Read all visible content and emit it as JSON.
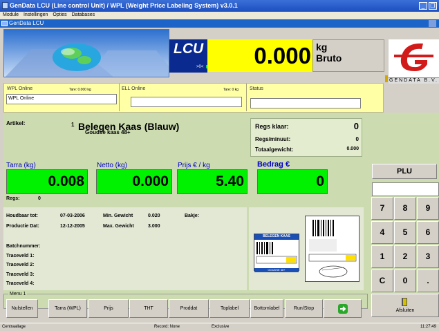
{
  "window": {
    "title": "GenData LCU (Line control Unit) / WPL (Weight Price Labeling System)  v3.0.1"
  },
  "menu": [
    "Module",
    "Instellingen",
    "Opties",
    "Databases"
  ],
  "subwindow": {
    "title": "GenData LCU"
  },
  "lcu": {
    "label": "LCU",
    "sub": ">0<"
  },
  "weight": {
    "value": "0.000",
    "unit": "kg",
    "mode": "Bruto"
  },
  "logo": {
    "text": "GENDATA B.V."
  },
  "wpl": {
    "label": "WPL Online",
    "tare": "Tare: 0.000 kg",
    "value": "WPL Online"
  },
  "ell": {
    "label": "ELL Online",
    "tare": "Tare: 0 kg",
    "value": ""
  },
  "status": {
    "label": "Status",
    "value": ""
  },
  "article": {
    "label": "Artikel:",
    "number": "1",
    "name": "Belegen Kaas (Blauw)",
    "sub": "Goudse kaas 48+"
  },
  "summary": {
    "regs_klaar_label": "Regs klaar:",
    "regs_klaar": "0",
    "regs_min_label": "Regs/minuut:",
    "regs_min": "0",
    "totaal_label": "Totaalgewicht:",
    "totaal": "0.000"
  },
  "fields": {
    "tarra_label": "Tarra (kg)",
    "tarra": "0.008",
    "netto_label": "Netto (kg)",
    "netto": "0.000",
    "prijs_label": "Prijs € / kg",
    "prijs": "5.40",
    "bedrag_label": "Bedrag €",
    "bedrag": "0"
  },
  "regs": {
    "label": "Regs:",
    "value": "0"
  },
  "info": {
    "houdbaar_label": "Houdbaar tot:",
    "houdbaar": "07-03-2006",
    "min_label": "Min. Gewicht",
    "min": "0.020",
    "bakje_label": "Bakje:",
    "productie_label": "Productie Dat:",
    "productie": "12-12-2005",
    "max_label": "Max. Gewicht",
    "max": "3.000",
    "batch_label": "Batchnummer:",
    "tv1": "Traceveld 1:",
    "tv2": "Traceveld 2:",
    "tv3": "Traceveld 3:",
    "tv4": "Traceveld 4:"
  },
  "labels_preview": {
    "label1_title": "BELEGEN KAAS",
    "label1_footer": "GOUDSE 48+"
  },
  "function_menu": {
    "legend": "Menu 1",
    "buttons": [
      "Nulstellen",
      "Tarra (WPL)",
      "Prijs",
      "THT",
      "Proddat",
      "Toplabel",
      "Bottomlabel",
      "Run/Stop"
    ]
  },
  "plu": {
    "label": "PLU"
  },
  "keypad": [
    "7",
    "8",
    "9",
    "4",
    "5",
    "6",
    "1",
    "2",
    "3",
    "C",
    "0",
    "."
  ],
  "afsluiten": {
    "label": "Afsluiten"
  },
  "statusbar": {
    "left": "Centraallage",
    "record": "Record: None",
    "mode": "Exclusive",
    "time": "11:27:49"
  },
  "colors": {
    "weight_bg": "#ffff00",
    "field_bg": "#00f200",
    "panel_bg": "#ccdcb0",
    "label_blue": "#0000c8"
  }
}
